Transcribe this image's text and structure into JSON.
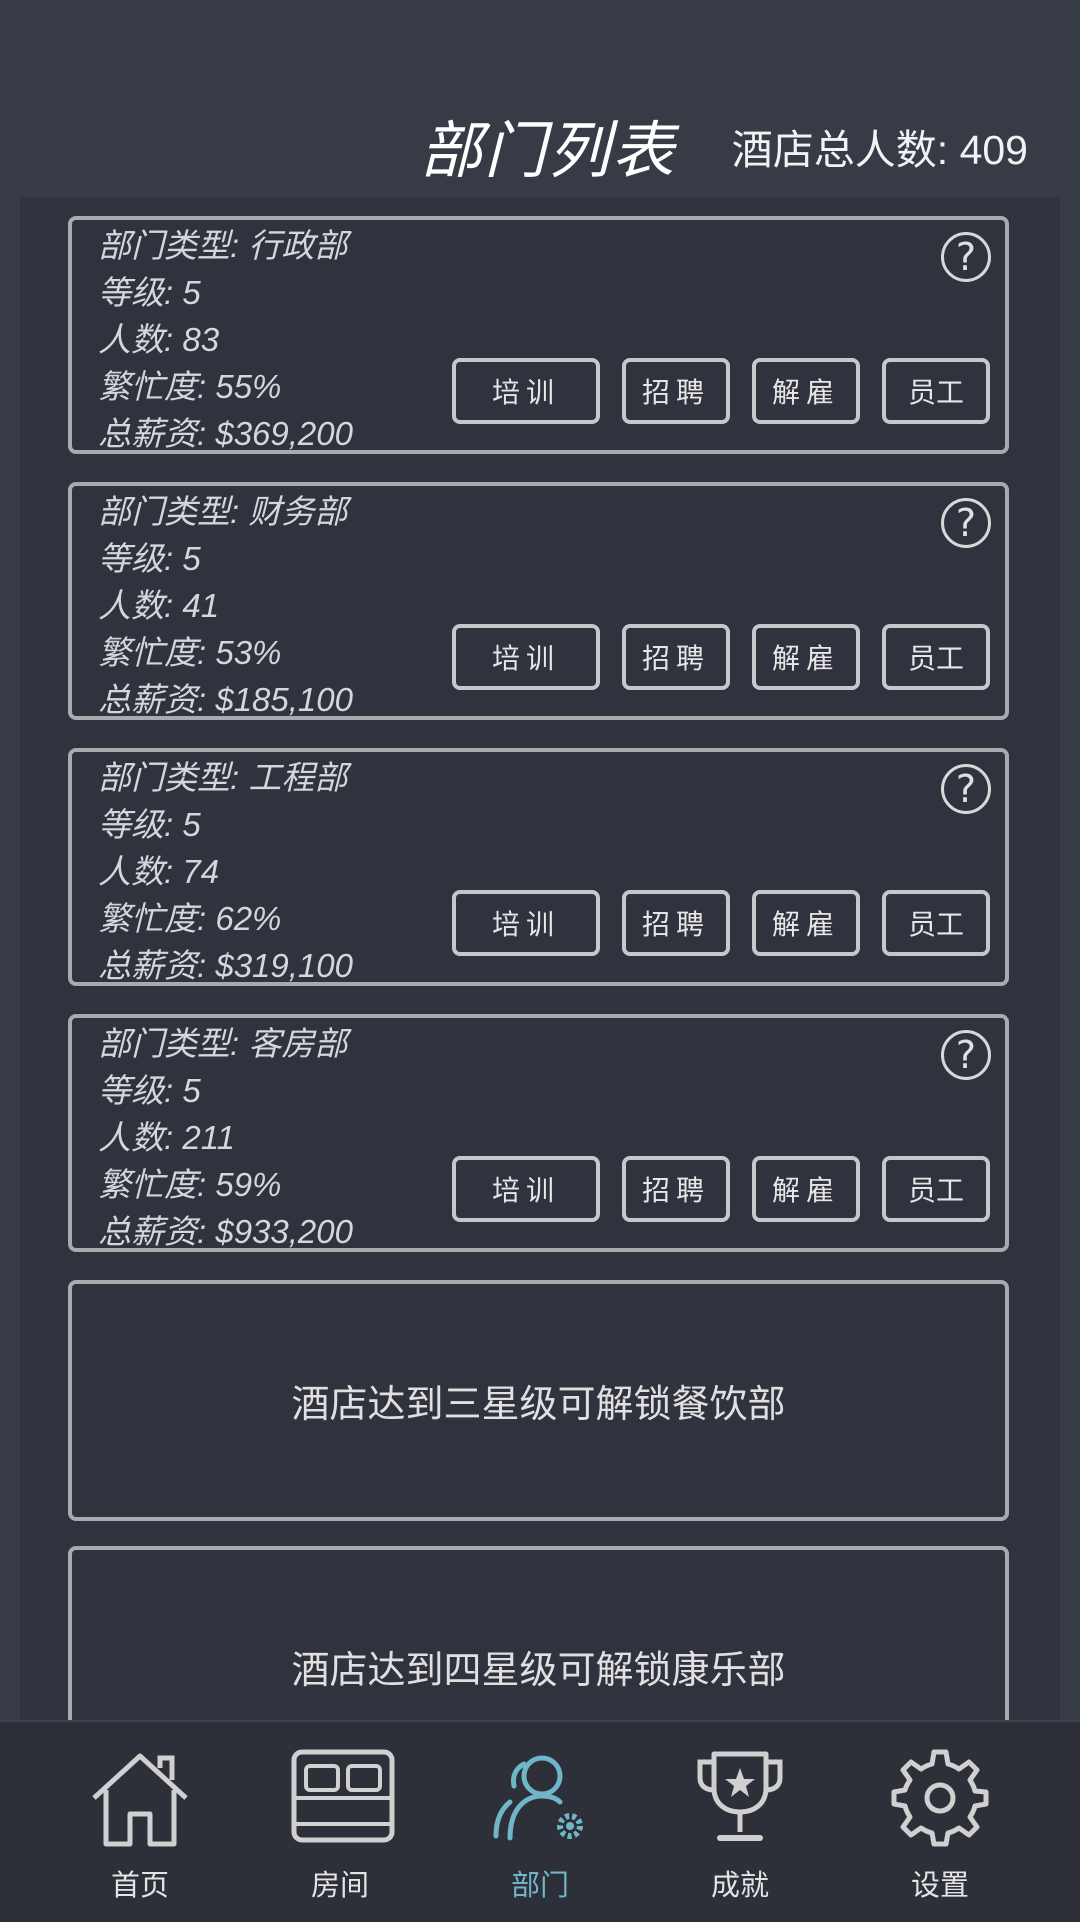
{
  "header": {
    "title": "部门列表",
    "total_label": "酒店总人数: 409"
  },
  "departments": [
    {
      "type": "部门类型: 行政部",
      "level": "等级: 5",
      "count": "人数: 83",
      "busy": "繁忙度: 55%",
      "salary": "总薪资: $369,200"
    },
    {
      "type": "部门类型: 财务部",
      "level": "等级: 5",
      "count": "人数: 41",
      "busy": "繁忙度: 53%",
      "salary": "总薪资: $185,100"
    },
    {
      "type": "部门类型: 工程部",
      "level": "等级: 5",
      "count": "人数: 74",
      "busy": "繁忙度: 62%",
      "salary": "总薪资: $319,100"
    },
    {
      "type": "部门类型: 客房部",
      "level": "等级: 5",
      "count": "人数: 211",
      "busy": "繁忙度: 59%",
      "salary": "总薪资: $933,200"
    }
  ],
  "actions": {
    "train": "培训",
    "hire": "招聘",
    "fire": "解雇",
    "staff": "员工",
    "help": "?"
  },
  "locked": [
    "酒店达到三星级可解锁餐饮部",
    "酒店达到四星级可解锁康乐部"
  ],
  "nav": {
    "items": [
      {
        "label": "首页",
        "icon": "home-icon"
      },
      {
        "label": "房间",
        "icon": "bed-icon"
      },
      {
        "label": "部门",
        "icon": "department-icon"
      },
      {
        "label": "成就",
        "icon": "trophy-icon"
      },
      {
        "label": "设置",
        "icon": "gear-icon"
      }
    ],
    "active": "部门",
    "active_color": "#6fb6c9"
  },
  "colors": {
    "background": "#373b45",
    "panel": "#30323d",
    "card_border": "#a8aaad"
  }
}
